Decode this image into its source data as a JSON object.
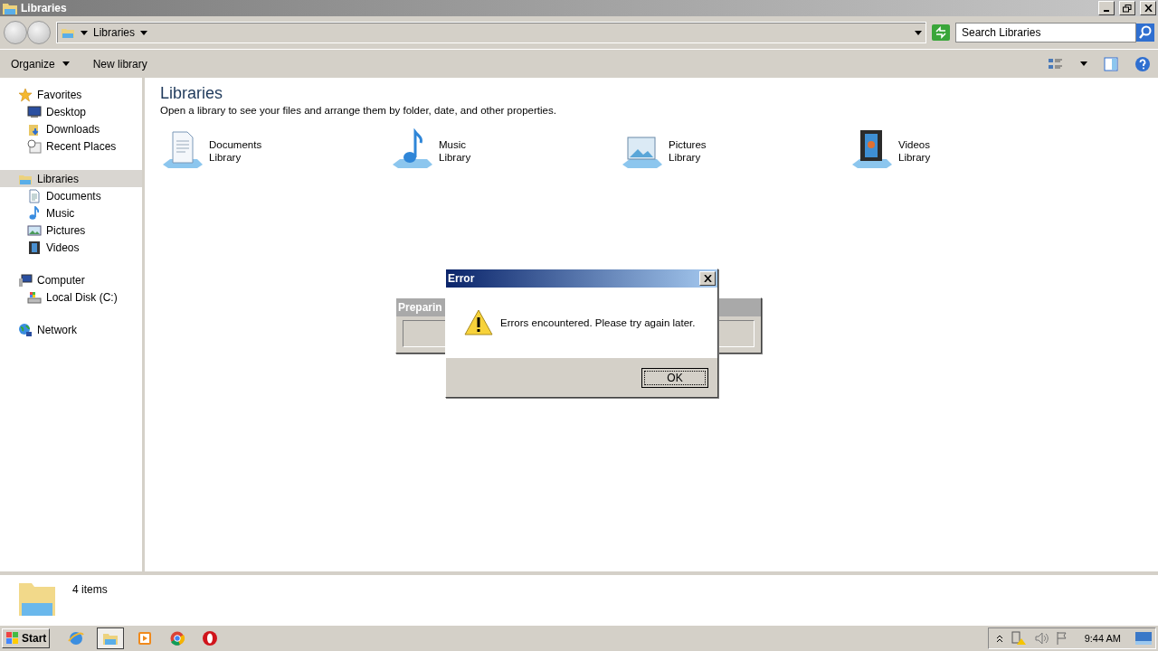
{
  "window": {
    "title": "Libraries"
  },
  "address_bar": {
    "crumb": "Libraries",
    "search": {
      "placeholder": "Search Libraries"
    }
  },
  "command_bar": {
    "buttons": [
      {
        "label": "Organize",
        "dropdown": true
      },
      {
        "label": "New library",
        "dropdown": false
      }
    ]
  },
  "nav": [
    {
      "label": "Favorites",
      "kind": "star",
      "selected": false,
      "children": [
        {
          "label": "Desktop",
          "kind": "monitor",
          "selected": false
        },
        {
          "label": "Downloads",
          "kind": "download",
          "selected": false
        },
        {
          "label": "Recent Places",
          "kind": "recent",
          "selected": false
        }
      ]
    },
    {
      "label": "Libraries",
      "kind": "library",
      "selected": true,
      "children": [
        {
          "label": "Documents",
          "kind": "document",
          "selected": false
        },
        {
          "label": "Music",
          "kind": "note",
          "selected": false
        },
        {
          "label": "Pictures",
          "kind": "picture",
          "selected": false
        },
        {
          "label": "Videos",
          "kind": "film",
          "selected": false
        }
      ]
    },
    {
      "label": "Computer",
      "kind": "computer",
      "selected": false,
      "children": [
        {
          "label": "Local Disk (C:)",
          "kind": "disk",
          "selected": false
        }
      ]
    },
    {
      "label": "Network",
      "kind": "globe",
      "selected": false
    }
  ],
  "content": {
    "heading": "Libraries",
    "description": "Open a library to see your files and arrange them by folder, date, and other properties.",
    "libraries": [
      {
        "name": "Documents",
        "type": "Library",
        "kind": "document"
      },
      {
        "name": "Music",
        "type": "Library",
        "kind": "note"
      },
      {
        "name": "Pictures",
        "type": "Library",
        "kind": "picture"
      },
      {
        "name": "Videos",
        "type": "Library",
        "kind": "film"
      }
    ]
  },
  "status": {
    "count": "4 items"
  },
  "background_dialog": {
    "title": "Preparin"
  },
  "error_dialog": {
    "title": "Error",
    "message": "Errors encountered. Please try again later.",
    "button": "OK"
  },
  "taskbar": {
    "start": "Start",
    "apps": [
      {
        "kind": "browser",
        "selected": false
      },
      {
        "kind": "folder",
        "selected": true
      },
      {
        "kind": "player",
        "selected": false
      },
      {
        "kind": "chrome",
        "selected": false
      },
      {
        "kind": "opera",
        "selected": false
      }
    ],
    "clock": "9:44 AM"
  }
}
